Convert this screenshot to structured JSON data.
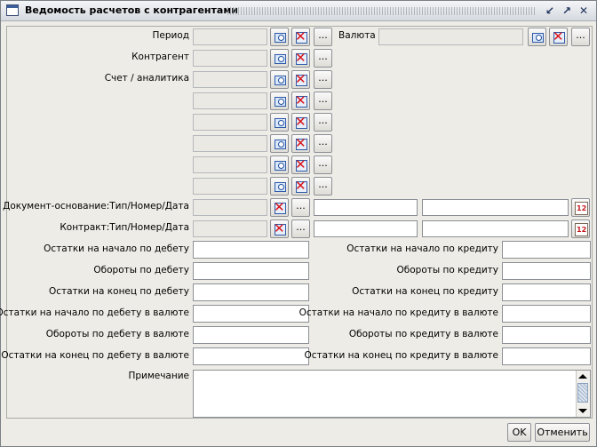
{
  "window": {
    "title": "Ведомость расчетов с контрагентами"
  },
  "form": {
    "period_label": "Период",
    "currency_label": "Валюта",
    "counterparty_label": "Контрагент",
    "account_label": "Счет / аналитика",
    "basis_doc_label": "Документ-основание:Тип/Номер/Дата",
    "contract_label": "Контракт:Тип/Номер/Дата",
    "debit_open_label": "Остатки на начало по дебету",
    "debit_turn_label": "Обороты по дебету",
    "debit_close_label": "Остатки на конец по дебету",
    "debit_open_cur_label": "Остатки на начало по дебету в валюте",
    "debit_turn_cur_label": "Обороты по дебету в валюте",
    "debit_close_cur_label": "Остатки на конец по дебету в валюте",
    "credit_open_label": "Остатки на начало по кредиту",
    "credit_turn_label": "Обороты по кредиту",
    "credit_close_label": "Остатки на конец по кредиту",
    "credit_open_cur_label": "Остатки на начало по кредиту в валюте",
    "credit_turn_cur_label": "Обороты по кредиту в валюте",
    "credit_close_cur_label": "Остатки на конец по кредиту в валюте",
    "note_label": "Примечание"
  },
  "buttons": {
    "more": "...",
    "ok": "OK",
    "cancel": "Отменить"
  },
  "icons": {
    "app": "window-icon",
    "minimize": "minimize-icon",
    "maximize": "maximize-icon",
    "close": "close-icon",
    "lookup": "lookup-icon",
    "clear": "clear-icon",
    "calendar": "calendar-icon"
  },
  "colors": {
    "panel": "#eeece6",
    "field_readonly": "#ebe9e3",
    "clear_red": "#d8141a",
    "lookup_blue": "#2d5aa8"
  }
}
